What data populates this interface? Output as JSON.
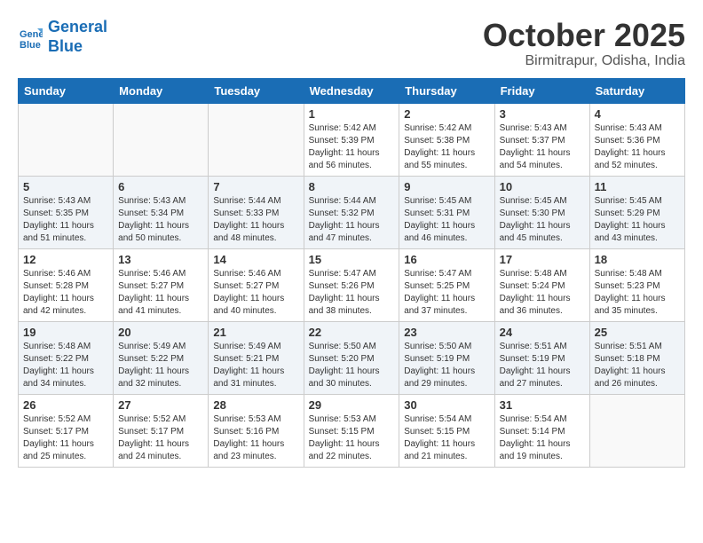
{
  "logo": {
    "line1": "General",
    "line2": "Blue"
  },
  "title": "October 2025",
  "location": "Birmitrapur, Odisha, India",
  "weekdays": [
    "Sunday",
    "Monday",
    "Tuesday",
    "Wednesday",
    "Thursday",
    "Friday",
    "Saturday"
  ],
  "rows": [
    [
      {
        "day": "",
        "sunrise": "",
        "sunset": "",
        "daylight": ""
      },
      {
        "day": "",
        "sunrise": "",
        "sunset": "",
        "daylight": ""
      },
      {
        "day": "",
        "sunrise": "",
        "sunset": "",
        "daylight": ""
      },
      {
        "day": "1",
        "sunrise": "Sunrise: 5:42 AM",
        "sunset": "Sunset: 5:39 PM",
        "daylight": "Daylight: 11 hours and 56 minutes."
      },
      {
        "day": "2",
        "sunrise": "Sunrise: 5:42 AM",
        "sunset": "Sunset: 5:38 PM",
        "daylight": "Daylight: 11 hours and 55 minutes."
      },
      {
        "day": "3",
        "sunrise": "Sunrise: 5:43 AM",
        "sunset": "Sunset: 5:37 PM",
        "daylight": "Daylight: 11 hours and 54 minutes."
      },
      {
        "day": "4",
        "sunrise": "Sunrise: 5:43 AM",
        "sunset": "Sunset: 5:36 PM",
        "daylight": "Daylight: 11 hours and 52 minutes."
      }
    ],
    [
      {
        "day": "5",
        "sunrise": "Sunrise: 5:43 AM",
        "sunset": "Sunset: 5:35 PM",
        "daylight": "Daylight: 11 hours and 51 minutes."
      },
      {
        "day": "6",
        "sunrise": "Sunrise: 5:43 AM",
        "sunset": "Sunset: 5:34 PM",
        "daylight": "Daylight: 11 hours and 50 minutes."
      },
      {
        "day": "7",
        "sunrise": "Sunrise: 5:44 AM",
        "sunset": "Sunset: 5:33 PM",
        "daylight": "Daylight: 11 hours and 48 minutes."
      },
      {
        "day": "8",
        "sunrise": "Sunrise: 5:44 AM",
        "sunset": "Sunset: 5:32 PM",
        "daylight": "Daylight: 11 hours and 47 minutes."
      },
      {
        "day": "9",
        "sunrise": "Sunrise: 5:45 AM",
        "sunset": "Sunset: 5:31 PM",
        "daylight": "Daylight: 11 hours and 46 minutes."
      },
      {
        "day": "10",
        "sunrise": "Sunrise: 5:45 AM",
        "sunset": "Sunset: 5:30 PM",
        "daylight": "Daylight: 11 hours and 45 minutes."
      },
      {
        "day": "11",
        "sunrise": "Sunrise: 5:45 AM",
        "sunset": "Sunset: 5:29 PM",
        "daylight": "Daylight: 11 hours and 43 minutes."
      }
    ],
    [
      {
        "day": "12",
        "sunrise": "Sunrise: 5:46 AM",
        "sunset": "Sunset: 5:28 PM",
        "daylight": "Daylight: 11 hours and 42 minutes."
      },
      {
        "day": "13",
        "sunrise": "Sunrise: 5:46 AM",
        "sunset": "Sunset: 5:27 PM",
        "daylight": "Daylight: 11 hours and 41 minutes."
      },
      {
        "day": "14",
        "sunrise": "Sunrise: 5:46 AM",
        "sunset": "Sunset: 5:27 PM",
        "daylight": "Daylight: 11 hours and 40 minutes."
      },
      {
        "day": "15",
        "sunrise": "Sunrise: 5:47 AM",
        "sunset": "Sunset: 5:26 PM",
        "daylight": "Daylight: 11 hours and 38 minutes."
      },
      {
        "day": "16",
        "sunrise": "Sunrise: 5:47 AM",
        "sunset": "Sunset: 5:25 PM",
        "daylight": "Daylight: 11 hours and 37 minutes."
      },
      {
        "day": "17",
        "sunrise": "Sunrise: 5:48 AM",
        "sunset": "Sunset: 5:24 PM",
        "daylight": "Daylight: 11 hours and 36 minutes."
      },
      {
        "day": "18",
        "sunrise": "Sunrise: 5:48 AM",
        "sunset": "Sunset: 5:23 PM",
        "daylight": "Daylight: 11 hours and 35 minutes."
      }
    ],
    [
      {
        "day": "19",
        "sunrise": "Sunrise: 5:48 AM",
        "sunset": "Sunset: 5:22 PM",
        "daylight": "Daylight: 11 hours and 34 minutes."
      },
      {
        "day": "20",
        "sunrise": "Sunrise: 5:49 AM",
        "sunset": "Sunset: 5:22 PM",
        "daylight": "Daylight: 11 hours and 32 minutes."
      },
      {
        "day": "21",
        "sunrise": "Sunrise: 5:49 AM",
        "sunset": "Sunset: 5:21 PM",
        "daylight": "Daylight: 11 hours and 31 minutes."
      },
      {
        "day": "22",
        "sunrise": "Sunrise: 5:50 AM",
        "sunset": "Sunset: 5:20 PM",
        "daylight": "Daylight: 11 hours and 30 minutes."
      },
      {
        "day": "23",
        "sunrise": "Sunrise: 5:50 AM",
        "sunset": "Sunset: 5:19 PM",
        "daylight": "Daylight: 11 hours and 29 minutes."
      },
      {
        "day": "24",
        "sunrise": "Sunrise: 5:51 AM",
        "sunset": "Sunset: 5:19 PM",
        "daylight": "Daylight: 11 hours and 27 minutes."
      },
      {
        "day": "25",
        "sunrise": "Sunrise: 5:51 AM",
        "sunset": "Sunset: 5:18 PM",
        "daylight": "Daylight: 11 hours and 26 minutes."
      }
    ],
    [
      {
        "day": "26",
        "sunrise": "Sunrise: 5:52 AM",
        "sunset": "Sunset: 5:17 PM",
        "daylight": "Daylight: 11 hours and 25 minutes."
      },
      {
        "day": "27",
        "sunrise": "Sunrise: 5:52 AM",
        "sunset": "Sunset: 5:17 PM",
        "daylight": "Daylight: 11 hours and 24 minutes."
      },
      {
        "day": "28",
        "sunrise": "Sunrise: 5:53 AM",
        "sunset": "Sunset: 5:16 PM",
        "daylight": "Daylight: 11 hours and 23 minutes."
      },
      {
        "day": "29",
        "sunrise": "Sunrise: 5:53 AM",
        "sunset": "Sunset: 5:15 PM",
        "daylight": "Daylight: 11 hours and 22 minutes."
      },
      {
        "day": "30",
        "sunrise": "Sunrise: 5:54 AM",
        "sunset": "Sunset: 5:15 PM",
        "daylight": "Daylight: 11 hours and 21 minutes."
      },
      {
        "day": "31",
        "sunrise": "Sunrise: 5:54 AM",
        "sunset": "Sunset: 5:14 PM",
        "daylight": "Daylight: 11 hours and 19 minutes."
      },
      {
        "day": "",
        "sunrise": "",
        "sunset": "",
        "daylight": ""
      }
    ]
  ]
}
